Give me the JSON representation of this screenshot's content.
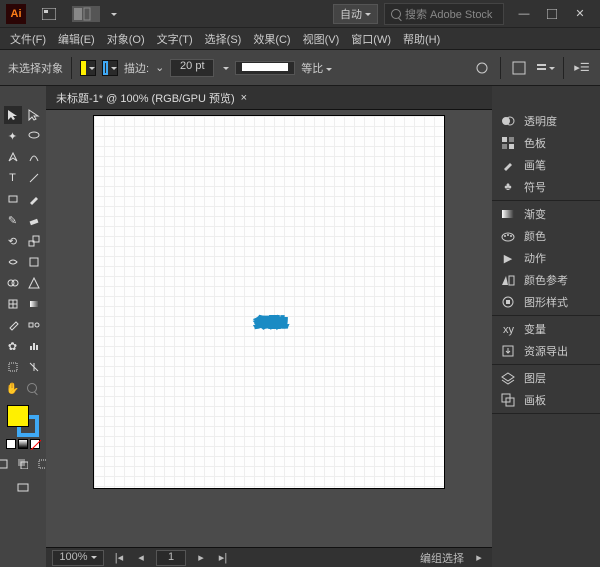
{
  "titlebar": {
    "auto_label": "自动",
    "search_placeholder": "搜索 Adobe Stock"
  },
  "menubar": {
    "items": [
      {
        "label": "文件(F)"
      },
      {
        "label": "编辑(E)"
      },
      {
        "label": "对象(O)"
      },
      {
        "label": "文字(T)"
      },
      {
        "label": "选择(S)"
      },
      {
        "label": "效果(C)"
      },
      {
        "label": "视图(V)"
      },
      {
        "label": "窗口(W)"
      },
      {
        "label": "帮助(H)"
      }
    ]
  },
  "optionbar": {
    "selection_label": "未选择对象",
    "stroke_label": "描边:",
    "stroke_value": "20 pt",
    "profile_label": "等比"
  },
  "doctab": {
    "title": "未标题-1* @ 100% (RGB/GPU 预览)"
  },
  "artwork": {
    "text": "多层描边"
  },
  "statusbar": {
    "zoom": "100%",
    "page": "1",
    "mode": "编组选择"
  },
  "right_panels": [
    {
      "group": 1,
      "name": "transparency",
      "label": "透明度"
    },
    {
      "group": 1,
      "name": "swatches",
      "label": "色板"
    },
    {
      "group": 1,
      "name": "brushes",
      "label": "画笔"
    },
    {
      "group": 1,
      "name": "symbols",
      "label": "符号"
    },
    {
      "group": 2,
      "name": "gradient",
      "label": "渐变"
    },
    {
      "group": 2,
      "name": "color",
      "label": "颜色"
    },
    {
      "group": 2,
      "name": "actions",
      "label": "动作"
    },
    {
      "group": 2,
      "name": "color-guide",
      "label": "颜色参考"
    },
    {
      "group": 2,
      "name": "graphic-styles",
      "label": "图形样式"
    },
    {
      "group": 3,
      "name": "variables",
      "label": "变量"
    },
    {
      "group": 3,
      "name": "asset-export",
      "label": "资源导出"
    },
    {
      "group": 4,
      "name": "layers",
      "label": "图层"
    },
    {
      "group": 4,
      "name": "artboards",
      "label": "画板"
    }
  ],
  "colors": {
    "fill": "#fff000",
    "stroke": "#3fa9f5"
  }
}
